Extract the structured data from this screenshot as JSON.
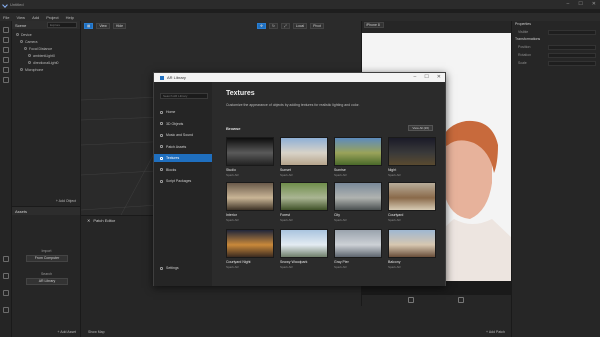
{
  "app": {
    "title": "Untitled"
  },
  "menu": [
    "File",
    "View",
    "Add",
    "Project",
    "Help"
  ],
  "scene": {
    "header": "Scene",
    "search_placeholder": "Explore",
    "tree": [
      "Device",
      "Camera",
      "Focal Distance",
      "ambientLight0",
      "directionalLight0",
      "Microphone"
    ],
    "add_object": "+ Add Object"
  },
  "assets": {
    "header": "Assets",
    "import_label": "Import",
    "import_button": "From Computer",
    "search_label": "Search",
    "search_button": "AR Library",
    "add_asset": "+ Add Asset"
  },
  "viewport": {
    "toolbar": [
      "View",
      "Hide"
    ],
    "local": "Local",
    "pivot": "Pivot"
  },
  "patch_editor": {
    "title": "Patch Editor",
    "show_map": "Show Map",
    "add_patch": "+ Add Patch"
  },
  "simulator": {
    "device": "iPhone 8"
  },
  "properties": {
    "header": "Properties",
    "visible": "Visible",
    "transformations": "Transformations",
    "position": "Position",
    "rotation": "Rotation",
    "scale": "Scale"
  },
  "library": {
    "window_title": "AR Library",
    "search_placeholder": "Search AR Library",
    "nav": [
      {
        "label": "Home",
        "icon": "home-icon"
      },
      {
        "label": "3D Objects",
        "icon": "cube-icon"
      },
      {
        "label": "Music and Sound",
        "icon": "music-icon"
      },
      {
        "label": "Patch Assets",
        "icon": "patch-icon"
      },
      {
        "label": "Textures",
        "icon": "texture-icon"
      },
      {
        "label": "Blocks",
        "icon": "block-icon"
      },
      {
        "label": "Script Packages",
        "icon": "script-icon"
      }
    ],
    "active_nav": 4,
    "settings": "Settings",
    "heading": "Textures",
    "description": "Customize the appearance of objects by adding textures for realistic lighting and color.",
    "browse": "Browse",
    "view_all": "View All (26)",
    "items": [
      {
        "name": "Studio",
        "source": "Spark AR",
        "colors": [
          "#0d0d0d",
          "#5a5a5a",
          "#222222"
        ]
      },
      {
        "name": "Sunset",
        "source": "Spark AR",
        "colors": [
          "#8fb0d6",
          "#d8d3c8",
          "#b6a48c"
        ]
      },
      {
        "name": "Sunrise",
        "source": "Spark AR",
        "colors": [
          "#5d8bbd",
          "#9aa35a",
          "#4a6a2a"
        ]
      },
      {
        "name": "Night",
        "source": "Spark AR",
        "colors": [
          "#1b1b28",
          "#3a3a3a",
          "#5a4a30"
        ]
      },
      {
        "name": "Interior",
        "source": "Spark AR",
        "colors": [
          "#6a5a4a",
          "#c9b596",
          "#3d3226"
        ]
      },
      {
        "name": "Forest",
        "source": "Spark AR",
        "colors": [
          "#6f8e4b",
          "#aab593",
          "#3f5128"
        ]
      },
      {
        "name": "City",
        "source": "Spark AR",
        "colors": [
          "#7a8a9a",
          "#b0b3b0",
          "#4a5050"
        ]
      },
      {
        "name": "Courtyard",
        "source": "Spark AR",
        "colors": [
          "#b8ad9a",
          "#8a6a4a",
          "#d7cbb4"
        ]
      },
      {
        "name": "Courtyard Night",
        "source": "Spark AR",
        "colors": [
          "#20263a",
          "#c9893a",
          "#3a2a20"
        ]
      },
      {
        "name": "Snowy Woodpark",
        "source": "Spark AR",
        "colors": [
          "#a9c4de",
          "#e4ecf2",
          "#6f7f6a"
        ]
      },
      {
        "name": "Gray Pier",
        "source": "Spark AR",
        "colors": [
          "#9aa3ad",
          "#cdd1d6",
          "#5d656e"
        ]
      },
      {
        "name": "Balcony",
        "source": "Spark AR",
        "colors": [
          "#9fb7d1",
          "#d7c7b0",
          "#6a4e3a"
        ]
      }
    ]
  }
}
